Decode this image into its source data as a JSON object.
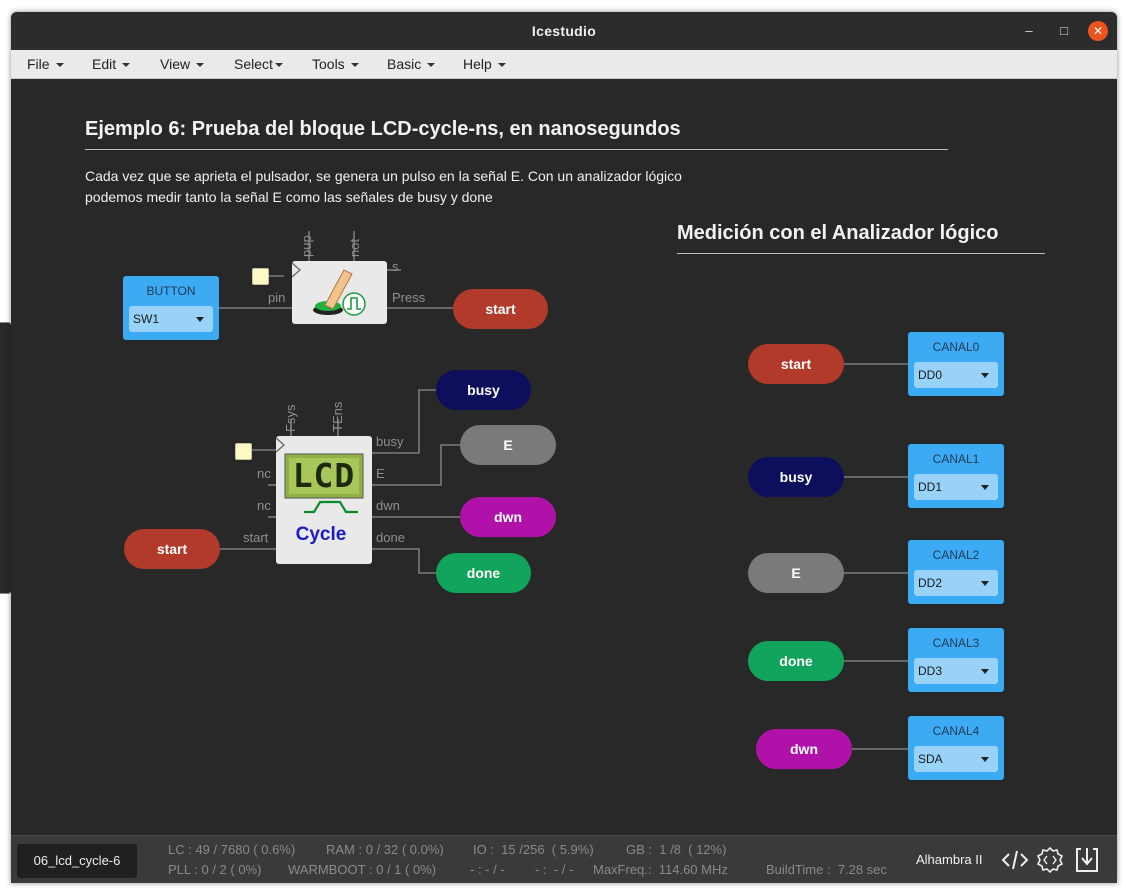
{
  "window": {
    "title": "Icestudio"
  },
  "menu": [
    "File",
    "Edit",
    "View",
    "Select",
    "Tools",
    "Basic",
    "Help"
  ],
  "doc": {
    "heading": "Ejemplo 6: Prueba del bloque LCD-cycle-ns, en nanosegundos",
    "desc_line1": "Cada vez que se aprieta el pulsador, se genera un pulso en la señal E. Con un analizador lógico",
    "desc_line2": "podemos medir tanto la señal E como las señales de busy y done",
    "heading2": "Medición con el Analizador lógico"
  },
  "button_block": {
    "label": "BUTTON",
    "value": "SW1",
    "pin_label": "pin"
  },
  "press_block": {
    "top_ports": [
      "pup",
      "not"
    ],
    "out_ports": [
      "s",
      "Press"
    ]
  },
  "lcd_block": {
    "top_ports": [
      "Fsys",
      "TEns"
    ],
    "in_ports": [
      "nc",
      "nc",
      "start"
    ],
    "out_ports": [
      "busy",
      "E",
      "dwn",
      "done"
    ],
    "display_text": "LCD",
    "caption": "Cycle"
  },
  "left_labels": {
    "start_top": "start",
    "busy": "busy",
    "e": "E",
    "dwn": "dwn",
    "start_bottom": "start",
    "done": "done"
  },
  "analyzer": [
    {
      "label_pill": "start",
      "canal": "CANAL0",
      "pin": "DD0",
      "color": "#b13a2b"
    },
    {
      "label_pill": "busy",
      "canal": "CANAL1",
      "pin": "DD1",
      "color": "#0e0f5c"
    },
    {
      "label_pill": "E",
      "canal": "CANAL2",
      "pin": "DD2",
      "color": "#7a7a7a"
    },
    {
      "label_pill": "done",
      "canal": "CANAL3",
      "pin": "DD3",
      "color": "#12a35c"
    },
    {
      "label_pill": "dwn",
      "canal": "CANAL4",
      "pin": "SDA",
      "color": "#b012a9"
    }
  ],
  "status": {
    "file_tab": "06_lcd_cycle-6",
    "lc": "LC : 49 / 7680 ( 0.6%)",
    "ram": "RAM : 0 / 32 ( 0.0%)",
    "io": "IO :  15 /256  ( 5.9%)",
    "gb": "GB :  1 /8  ( 12%)",
    "pll": "PLL : 0 / 2 ( 0%)",
    "warmboot": "WARMBOOT : 0 / 1 ( 0%)",
    "dash1": "- : - / -",
    "dash2": "- :  - / -",
    "maxfreq": "MaxFreq.:  114.60 MHz",
    "buildtime": "BuildTime :  7.28 sec",
    "board": "Alhambra II"
  },
  "colors": {
    "red": "#b13a2b",
    "navy": "#0e0f5c",
    "gray": "#7a7a7a",
    "green": "#12a35c",
    "magenta": "#b012a9",
    "blue": "#3daaf4"
  },
  "icons": [
    "code-icon",
    "gear-chip-icon",
    "download-icon",
    "minimize-icon",
    "maximize-icon",
    "close-icon"
  ]
}
